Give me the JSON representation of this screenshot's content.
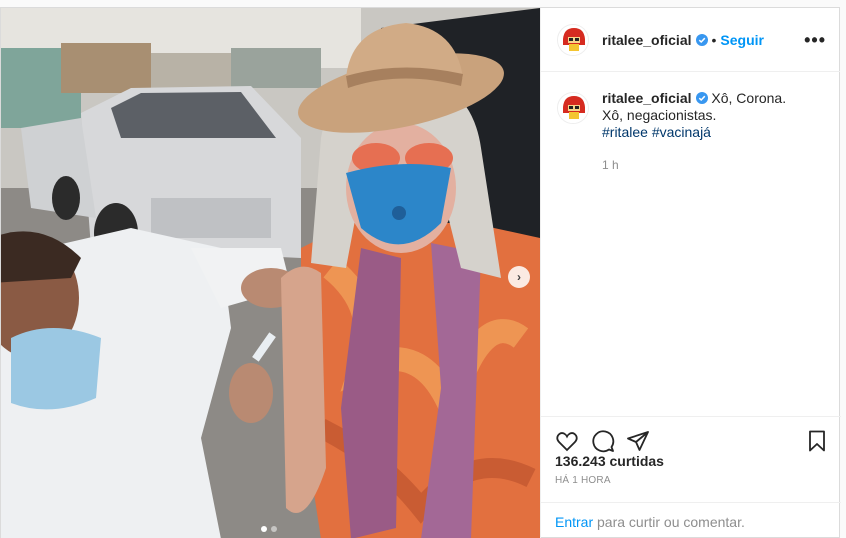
{
  "post": {
    "username": "ritalee_oficial",
    "separator": "•",
    "follow_label": "Seguir",
    "more_label": "•••",
    "caption": {
      "line1": "Xô, Corona.",
      "line2": "Xô, negacionistas.",
      "hashtags": [
        "#ritalee",
        "#vacinajá"
      ],
      "age": "1 h"
    },
    "likes_text": "136.243 curtidas",
    "posted_ago": "HÁ 1 HORA",
    "login_prompt": {
      "link": "Entrar",
      "rest": " para curtir ou comentar."
    },
    "carousel": {
      "current": 1,
      "total": 2
    }
  },
  "icons": {
    "like": "heart-icon",
    "comment": "comment-icon",
    "share": "paper-plane-icon",
    "save": "bookmark-icon",
    "verified": "verified-badge-icon",
    "next": "chevron-right-icon"
  },
  "colors": {
    "accent": "#0095f6",
    "hashtag": "#00376b",
    "muted": "#8e8e8e",
    "verified": "#3897f0"
  }
}
